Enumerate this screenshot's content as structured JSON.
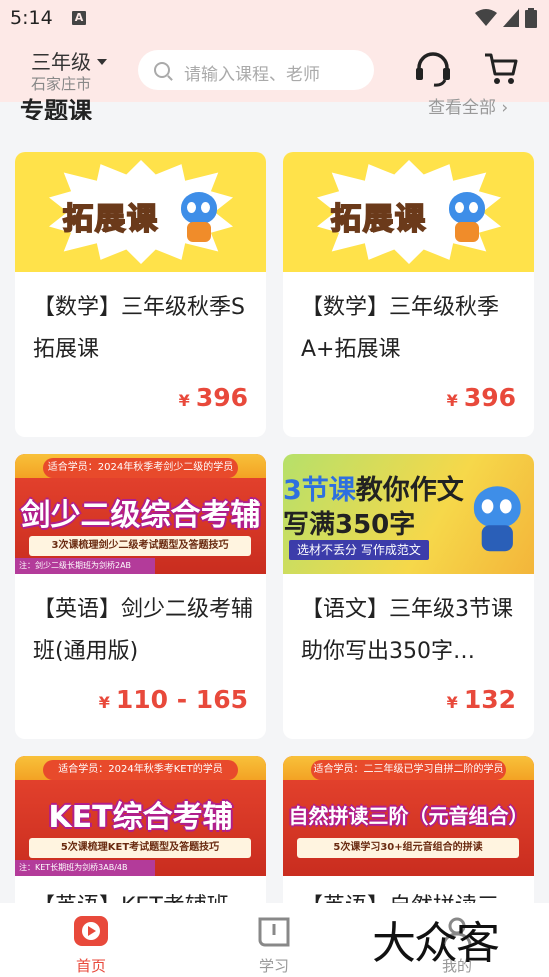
{
  "status_bar": {
    "time": "5:14",
    "notification_icon": "A"
  },
  "header": {
    "grade": "三年级",
    "city": "石家庄市",
    "search_placeholder": "请输入课程、老师",
    "icons": [
      "headset-icon",
      "cart-icon"
    ]
  },
  "section": {
    "title": "专题课",
    "more": "查看全部"
  },
  "cards": [
    {
      "banner": "拓展课",
      "title": "【数学】三年级秋季S拓展课",
      "price": "396",
      "currency": "¥"
    },
    {
      "banner": "拓展课",
      "title": "【数学】三年级秋季A+拓展课",
      "price": "396",
      "currency": "¥"
    },
    {
      "banner_top": "适合学员：2024年秋季考剑少二级的学员",
      "banner": "剑少二级综合考辅",
      "banner_sub": "3次课梳理剑少二级考试题型及答题技巧",
      "banner_foot": "注：剑少二级长期班为剑桥2AB",
      "title": "【英语】剑少二级考辅班(通用版)",
      "price": "110 - 165",
      "currency": "¥"
    },
    {
      "banner_l1a": "3节课",
      "banner_l1b": "教你作文",
      "banner_l2": "写满350字",
      "banner_tag": "选材不丢分 写作成范文",
      "title": "【语文】三年级3节课助你写出350字…",
      "price": "132",
      "currency": "¥"
    },
    {
      "banner_top": "适合学员：2024年秋季考KET的学员",
      "banner": "KET综合考辅",
      "banner_sub": "5次课梳理KET考试题型及答题技巧",
      "banner_foot": "注：KET长期班为剑桥3AB/4B",
      "title": "【英语】KET考辅班",
      "price": "",
      "currency": "¥"
    },
    {
      "banner_top": "适合学员：二三年级已学习自拼二阶的学员",
      "banner": "自然拼读三阶（元音组合）",
      "banner_sub": "5次课学习30+组元音组合的拼读",
      "title": "【英语】自然拼读三",
      "price": "",
      "currency": "¥"
    }
  ],
  "bottom_nav": [
    {
      "label": "首页",
      "icon": "home-play-icon",
      "active": true
    },
    {
      "label": "学习",
      "icon": "study-book-icon",
      "active": false
    },
    {
      "label": "我的",
      "icon": "profile-icon",
      "active": false
    }
  ],
  "watermark": "大众客",
  "colors": {
    "accent": "#e8493b",
    "header_bg": "#fde9e7",
    "page_bg": "#f4f5f7"
  }
}
